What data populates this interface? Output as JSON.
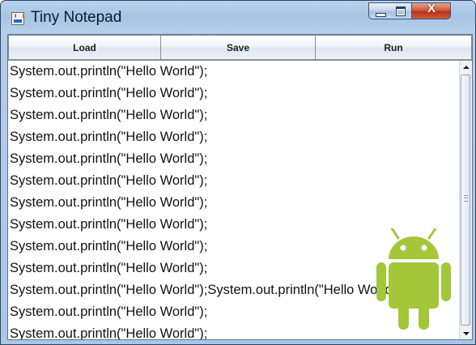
{
  "window": {
    "title": "Tiny Notepad",
    "icon": "java-cup-icon",
    "controls": {
      "minimize": "minimize-icon",
      "maximize": "maximize-icon",
      "close_glyph": "X"
    }
  },
  "toolbar": {
    "buttons": [
      {
        "label": "Load"
      },
      {
        "label": "Save"
      },
      {
        "label": "Run"
      }
    ]
  },
  "editor": {
    "lines": [
      "System.out.println(\"Hello World\");",
      "System.out.println(\"Hello World\");",
      "System.out.println(\"Hello World\");",
      "System.out.println(\"Hello World\");",
      "System.out.println(\"Hello World\");",
      "System.out.println(\"Hello World\");",
      "System.out.println(\"Hello World\");",
      "System.out.println(\"Hello World\");",
      "System.out.println(\"Hello World\");",
      "System.out.println(\"Hello World\");",
      "System.out.println(\"Hello World\");System.out.println(\"Hello World\");",
      "System.out.println(\"Hello World\");",
      "System.out.println(\"Hello World\");"
    ]
  },
  "overlay": {
    "icon": "android-robot-icon",
    "color": "#a4c639"
  }
}
